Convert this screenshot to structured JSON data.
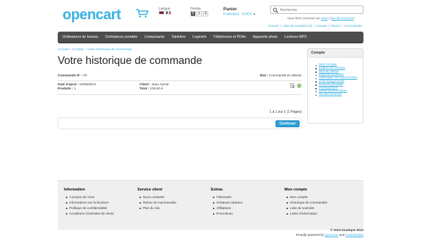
{
  "header": {
    "logo": "opencart",
    "language_label": "Langue",
    "currency_label": "Devise",
    "currencies": [
      "€",
      "£",
      "$"
    ],
    "cart_title": "Panier",
    "cart_summary": "0 article(s) - 0,00 €",
    "search_placeholder": "Recherche",
    "welcome_prefix": "Vous êtes connecté sur",
    "welcome_user": "Jean",
    "welcome_logout": "Se déconnecter",
    "links": [
      "Accueil",
      "Liste de souhaits (0)",
      "Compte",
      "Panier",
      "Commander"
    ],
    "colors": {
      "accent": "#38b0e3",
      "menu_bg": "#4d4d4d",
      "button": "#2e9fd8"
    }
  },
  "menu": {
    "items": [
      "Ordinateurs de bureau",
      "Ordinateurs portable",
      "Composants",
      "Tablettes",
      "Logiciels",
      "Téléphones et PDAs",
      "Appareils photo",
      "Lecteurs MP3"
    ]
  },
  "breadcrumb": [
    "Accueil",
    "Compte",
    "Votre historique de commande"
  ],
  "page_title": "Votre historique de commande",
  "order": {
    "number_label": "Commande N° :",
    "number": "#2",
    "status_label": "État :",
    "status": "Commande en attente",
    "date_label": "Date d'ajout :",
    "date": "18/09/2013",
    "products_label": "Produits :",
    "products": "1",
    "customer_label": "Client :",
    "customer": "Jean Aymar",
    "total_label": "Total :",
    "total": "105,00 €",
    "icons": [
      "view-icon",
      "reorder-icon"
    ]
  },
  "pagination": "1 à 1 sur 1 (1 Pages)",
  "continue_label": "Continuer",
  "sidebar": {
    "title": "Compte",
    "items": [
      "Mon compte",
      "Édition du compte",
      "Mot de passe",
      "Liste de souhaits",
      "Historique de commandes",
      "Téléchargements",
      "Retours produits",
      "Transactions",
      "Lettre d'information",
      "Se déconnecter"
    ]
  },
  "footer": {
    "columns": [
      {
        "title": "Information",
        "items": [
          "A propos de nous",
          "Informations sur la livraison",
          "Politique de confidentialité",
          "Conditions Générales de Vente"
        ]
      },
      {
        "title": "Service client",
        "items": [
          "Nous contacter",
          "Retour de marchandise",
          "Plan du site"
        ]
      },
      {
        "title": "Extras",
        "items": [
          "Fabricants",
          "Chèques-cadeaux",
          "Affiliations",
          "Promotions"
        ]
      },
      {
        "title": "Mon compte",
        "items": [
          "Mon compte",
          "Historique de commandes",
          "Liste de souhaits",
          "Lettre d'information"
        ]
      }
    ],
    "copyright": "© Votre boutique 2013",
    "powered_prefix": "Proudly powered by",
    "powered_a": "OpenCart",
    "powered_and": "and",
    "powered_b": "CodeKrinkite"
  }
}
